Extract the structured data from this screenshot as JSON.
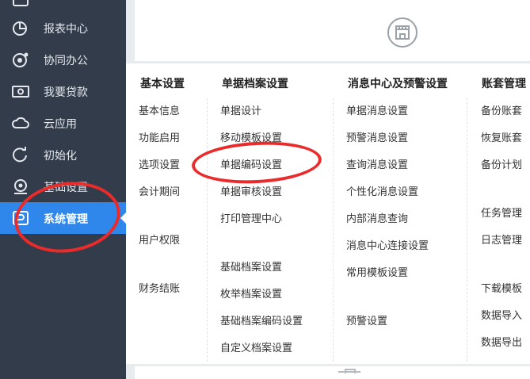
{
  "sidebar": {
    "items": [
      {
        "label": "报表中心",
        "icon": "pie-chart-icon"
      },
      {
        "label": "协同办公",
        "icon": "collab-icon"
      },
      {
        "label": "我要贷款",
        "icon": "money-icon"
      },
      {
        "label": "云应用",
        "icon": "cloud-icon"
      },
      {
        "label": "初始化",
        "icon": "init-icon"
      },
      {
        "label": "基础设置",
        "icon": "settings-icon"
      },
      {
        "label": "系统管理",
        "icon": "system-icon",
        "active": true
      }
    ]
  },
  "menu": {
    "columns": [
      {
        "header": "基本设置",
        "items": [
          "基本信息",
          "功能启用",
          "选项设置",
          "会计期间",
          "用户权限",
          "财务结账"
        ]
      },
      {
        "header": "单据档案设置",
        "items": [
          "单据设计",
          "移动模板设置",
          "单据编码设置",
          "单据审核设置",
          "打印管理中心",
          "基础档案设置",
          "枚举档案设置",
          "基础档案编码设置",
          "自定义档案设置"
        ]
      },
      {
        "header": "消息中心及预警设置",
        "items": [
          "单据消息设置",
          "预警消息设置",
          "查询消息设置",
          "个性化消息设置",
          "内部消息查询",
          "消息中心连接设置",
          "常用模板设置",
          "预警设置"
        ]
      },
      {
        "header": "账套管理",
        "items": [
          "备份账套",
          "恢复账套",
          "备份计划",
          "任务管理",
          "日志管理",
          "下载模板",
          "数据导入",
          "数据导出"
        ]
      }
    ]
  },
  "colors": {
    "sidebar_bg": "#323c4a",
    "active_bg": "#2f87ec",
    "annotation_red": "#ea2b2b"
  }
}
